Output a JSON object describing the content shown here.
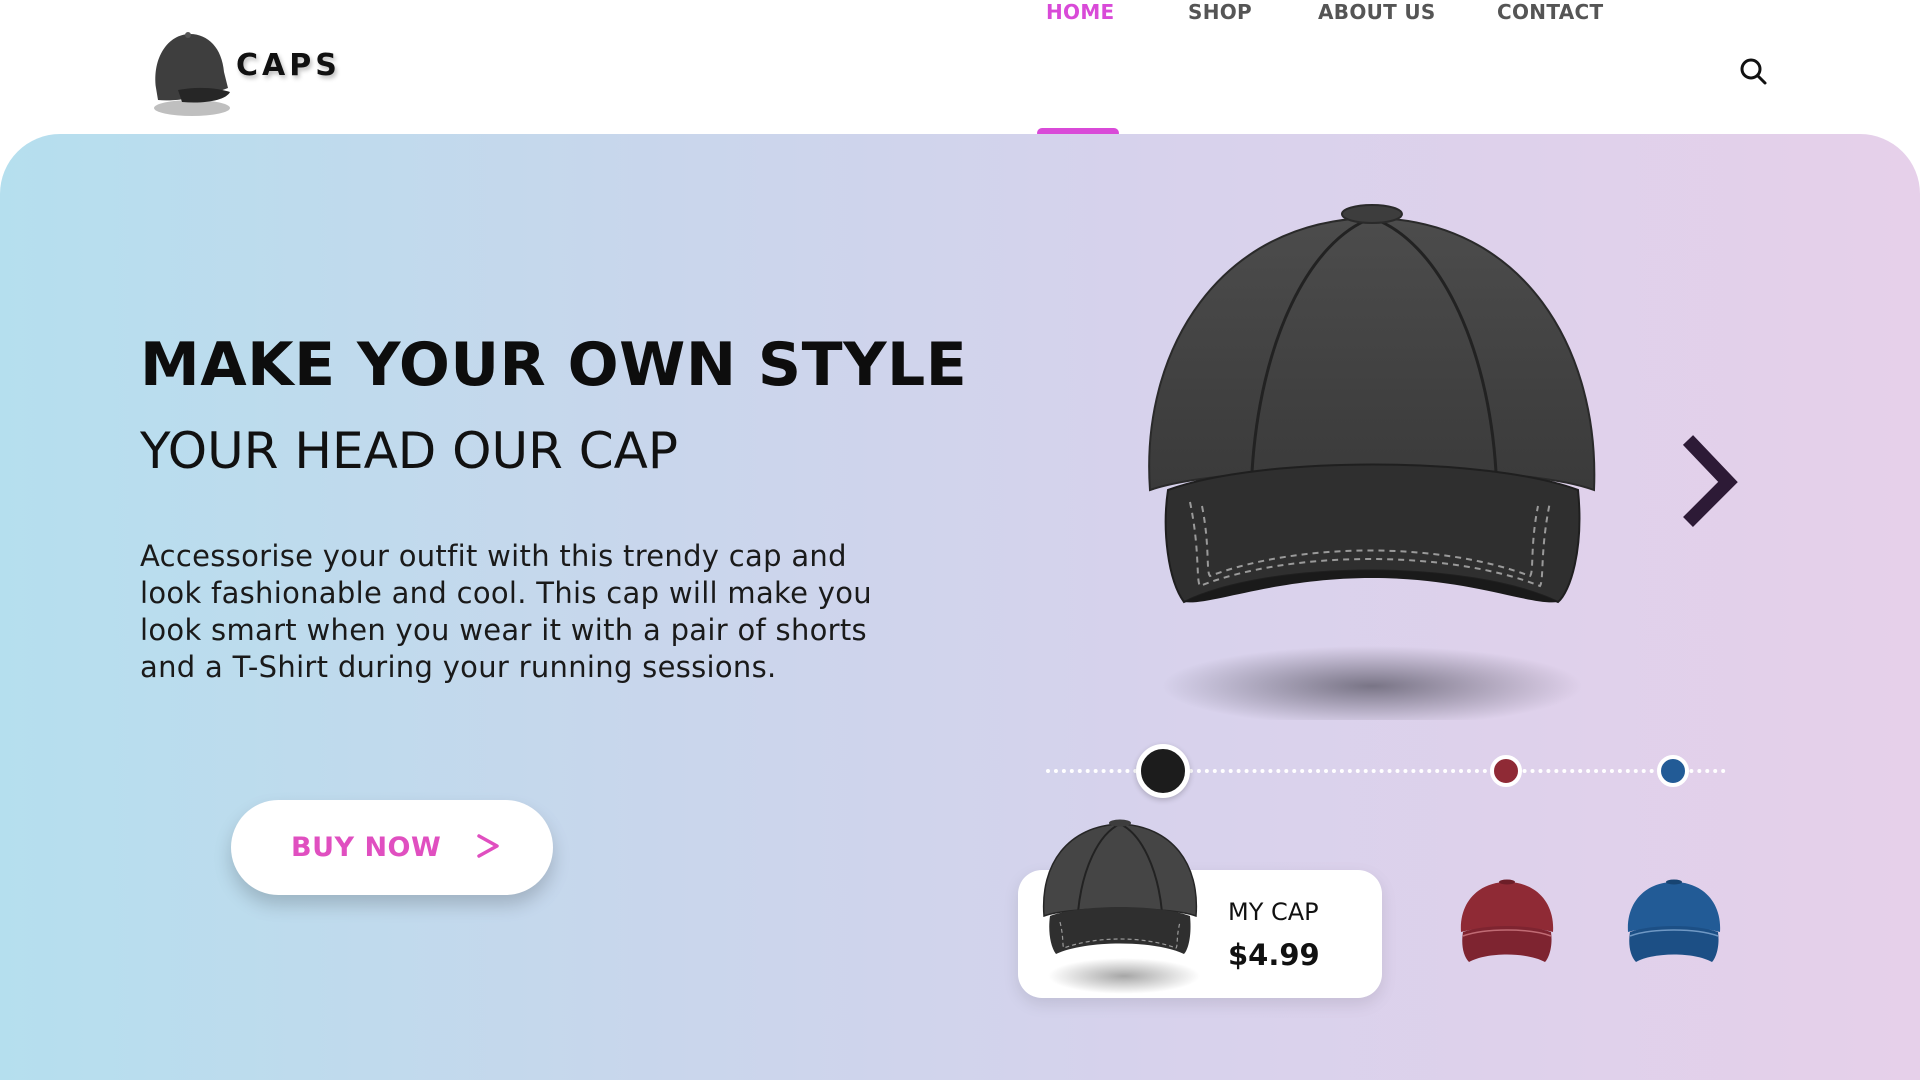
{
  "brand": {
    "name": "CAPS",
    "logo_icon": "cap-icon"
  },
  "nav": {
    "items": [
      {
        "label": "HOME",
        "active": true
      },
      {
        "label": "SHOP",
        "active": false
      },
      {
        "label": "ABOUT US",
        "active": false
      },
      {
        "label": "CONTACT",
        "active": false
      }
    ],
    "search_icon": "search-icon"
  },
  "hero": {
    "headline": "MAKE YOUR OWN STYLE",
    "subheadline": "YOUR HEAD OUR CAP",
    "description": "Accessorise your outfit with this trendy cap and look fashionable and cool. This cap will make you look smart when you wear it with a pair of shorts and a T-Shirt during your running sessions.",
    "buy_button": {
      "label": "BUY NOW",
      "icon": "arrow-right-icon"
    },
    "next_icon": "chevron-right-icon"
  },
  "product": {
    "name": "MY CAP",
    "price": "$4.99",
    "colors": [
      {
        "name": "black",
        "hex": "#1c1c1c",
        "selected": true
      },
      {
        "name": "red",
        "hex": "#8f2a35",
        "selected": false
      },
      {
        "name": "blue",
        "hex": "#225b96",
        "selected": false
      }
    ]
  },
  "theme": {
    "accent": "#d94ad8",
    "button_text": "#e04fc0",
    "gradient_start": "#b5dfee",
    "gradient_end": "#e6d0ea"
  }
}
